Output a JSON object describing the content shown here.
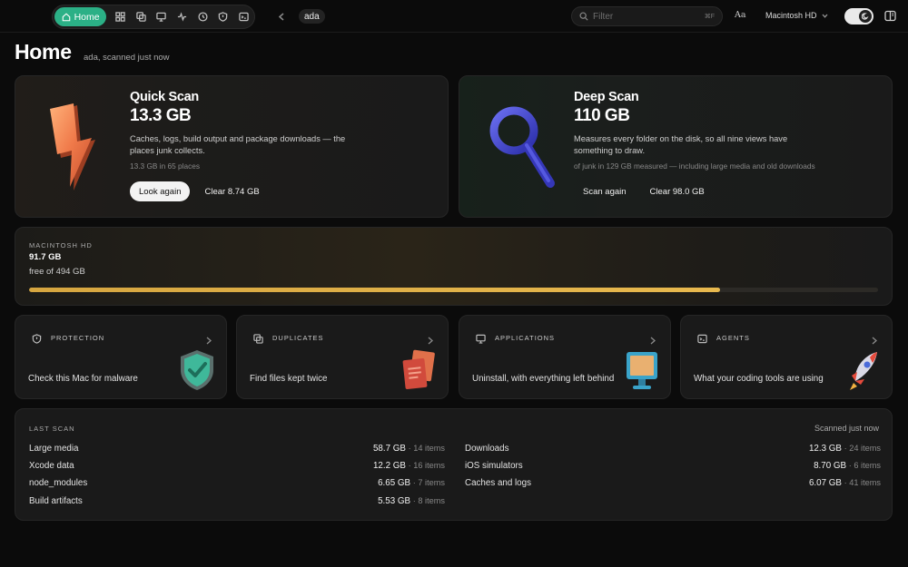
{
  "nav": {
    "home_label": "Home",
    "icons": [
      "grid-icon",
      "duplicates-icon",
      "monitor-icon",
      "activity-icon",
      "clock-icon",
      "shield-icon",
      "terminal-icon"
    ]
  },
  "user": "ada",
  "search": {
    "placeholder": "Filter",
    "shortcut": "⌘F"
  },
  "font_button": "Aa",
  "disk_selector": "Macintosh HD",
  "header": {
    "title": "Home",
    "subtitle": "ada, scanned just now"
  },
  "quick_scan": {
    "title": "Quick Scan",
    "size": "13.3 GB",
    "description": "Caches, logs, build output and package downloads — the places junk collects.",
    "meta": "13.3 GB in 65 places",
    "primary_action": "Look again",
    "secondary_action": "Clear 8.74 GB"
  },
  "deep_scan": {
    "title": "Deep Scan",
    "size": "110 GB",
    "description": "Measures every folder on the disk, so all nine views have something to draw.",
    "meta": "of junk in 129 GB measured — including large media and old downloads",
    "primary_action": "Scan again",
    "secondary_action": "Clear 98.0 GB"
  },
  "disk": {
    "label": "MACINTOSH HD",
    "free": "91.7 GB",
    "total": "free of 494 GB",
    "used_fraction": 0.814
  },
  "features": [
    {
      "title": "PROTECTION",
      "description": "Check this Mac for malware"
    },
    {
      "title": "DUPLICATES",
      "description": "Find files kept twice"
    },
    {
      "title": "APPLICATIONS",
      "description": "Uninstall, with everything left behind"
    },
    {
      "title": "AGENTS",
      "description": "What your coding tools are using"
    }
  ],
  "last_scan": {
    "label": "LAST SCAN",
    "time": "Scanned just now",
    "left": [
      {
        "name": "Large media",
        "size": "58.7 GB",
        "count": "· 14 items"
      },
      {
        "name": "Xcode data",
        "size": "12.2 GB",
        "count": "· 16 items"
      },
      {
        "name": "node_modules",
        "size": "6.65 GB",
        "count": "· 7 items"
      },
      {
        "name": "Build artifacts",
        "size": "5.53 GB",
        "count": "· 8 items"
      }
    ],
    "right": [
      {
        "name": "Downloads",
        "size": "12.3 GB",
        "count": "· 24 items"
      },
      {
        "name": "iOS simulators",
        "size": "8.70 GB",
        "count": "· 6 items"
      },
      {
        "name": "Caches and logs",
        "size": "6.07 GB",
        "count": "· 41 items"
      }
    ]
  },
  "colors": {
    "accent": "#2bb086",
    "disk_bar": "#e0b045",
    "background": "#0b0b0b",
    "card": "#1a1a1a"
  }
}
